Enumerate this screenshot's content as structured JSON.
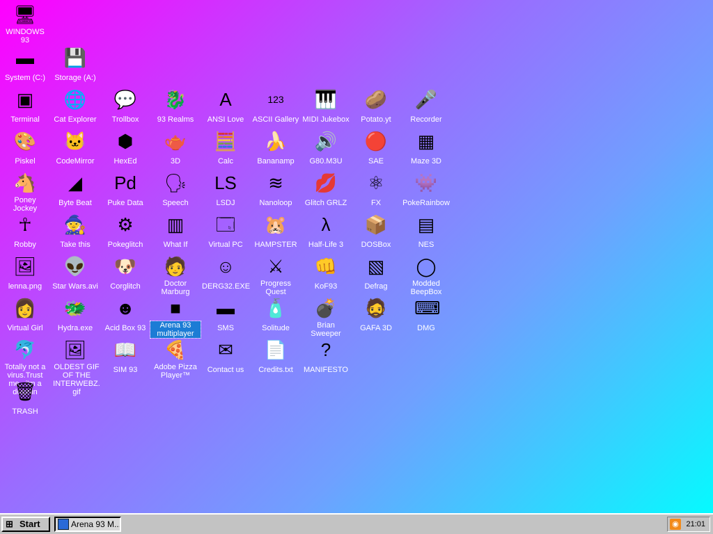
{
  "desktop": {
    "icons": [
      {
        "label": "WINDOWS 93",
        "glyph": "🖥",
        "name": "computer-icon"
      },
      {
        "label": "System (C:)",
        "glyph": "▬",
        "name": "drive-icon"
      },
      {
        "label": "Storage (A:)",
        "glyph": "💾",
        "name": "floppy-icon"
      },
      {
        "label": "Terminal",
        "glyph": "▣",
        "name": "terminal-icon"
      },
      {
        "label": "Cat Explorer",
        "glyph": "🌐",
        "name": "globe-icon"
      },
      {
        "label": "Trollbox",
        "glyph": "💬",
        "name": "chat-icon"
      },
      {
        "label": "93 Realms",
        "glyph": "🐉",
        "name": "dragon-icon"
      },
      {
        "label": "ANSI Love",
        "glyph": "A",
        "name": "ansi-icon"
      },
      {
        "label": "ASCII Gallery",
        "glyph": "123",
        "name": "ascii-icon"
      },
      {
        "label": "MIDI Jukebox",
        "glyph": "🎹",
        "name": "piano-icon"
      },
      {
        "label": "Potato.yt",
        "glyph": "🥔",
        "name": "potato-icon"
      },
      {
        "label": "Recorder",
        "glyph": "🎤",
        "name": "microphone-icon"
      },
      {
        "label": "Piskel",
        "glyph": "🎨",
        "name": "palette-icon"
      },
      {
        "label": "CodeMirror",
        "glyph": "🐱",
        "name": "cat-icon"
      },
      {
        "label": "HexEd",
        "glyph": "⬢",
        "name": "hexagon-icon"
      },
      {
        "label": "3D",
        "glyph": "🫖",
        "name": "teapot-icon"
      },
      {
        "label": "Calc",
        "glyph": "🧮",
        "name": "calculator-icon"
      },
      {
        "label": "Bananamp",
        "glyph": "🍌",
        "name": "banana-icon"
      },
      {
        "label": "G80.M3U",
        "glyph": "🔊",
        "name": "audio-file-icon"
      },
      {
        "label": "SAE",
        "glyph": "🔴",
        "name": "ball-icon"
      },
      {
        "label": "Maze 3D",
        "glyph": "▦",
        "name": "maze-icon"
      },
      {
        "label": "Poney Jockey",
        "glyph": "🐴",
        "name": "pony-icon"
      },
      {
        "label": "Byte Beat",
        "glyph": "◢",
        "name": "bytebeat-icon"
      },
      {
        "label": "Puke Data",
        "glyph": "Pd",
        "name": "puredata-icon"
      },
      {
        "label": "Speech",
        "glyph": "🗣",
        "name": "speech-icon"
      },
      {
        "label": "LSDJ",
        "glyph": "LS",
        "name": "lsdj-icon"
      },
      {
        "label": "Nanoloop",
        "glyph": "≋",
        "name": "wave-icon"
      },
      {
        "label": "Glitch GRLZ",
        "glyph": "💋",
        "name": "lips-icon"
      },
      {
        "label": "FX",
        "glyph": "⚛",
        "name": "atom-icon"
      },
      {
        "label": "PokeRainbow",
        "glyph": "👾",
        "name": "pokerainbow-icon"
      },
      {
        "label": "Robby",
        "glyph": "☥",
        "name": "stickman-icon"
      },
      {
        "label": "Take this",
        "glyph": "🧙",
        "name": "wizard-icon"
      },
      {
        "label": "Pokeglitch",
        "glyph": "⚙",
        "name": "pokeglitch-icon"
      },
      {
        "label": "What If",
        "glyph": "▥",
        "name": "whatif-icon"
      },
      {
        "label": "Virtual PC",
        "glyph": "🗔",
        "name": "window-icon"
      },
      {
        "label": "HAMPSTER",
        "glyph": "🐹",
        "name": "hamster-icon"
      },
      {
        "label": "Half-Life 3",
        "glyph": "λ",
        "name": "lambda-icon"
      },
      {
        "label": "DOSBox",
        "glyph": "📦",
        "name": "box-icon"
      },
      {
        "label": "NES",
        "glyph": "▤",
        "name": "nes-icon"
      },
      {
        "label": "lenna.png",
        "glyph": "🖼",
        "name": "image-file-icon"
      },
      {
        "label": "Star Wars.avi",
        "glyph": "👽",
        "name": "yoda-icon"
      },
      {
        "label": "Corglitch",
        "glyph": "🐶",
        "name": "corgi-icon"
      },
      {
        "label": "Doctor Marburg",
        "glyph": "🧑",
        "name": "doctor-icon"
      },
      {
        "label": "DERG32.EXE",
        "glyph": "☺",
        "name": "derg-icon"
      },
      {
        "label": "Progress Quest",
        "glyph": "⚔",
        "name": "swords-icon"
      },
      {
        "label": "KoF93",
        "glyph": "👊",
        "name": "fighter-icon"
      },
      {
        "label": "Defrag",
        "glyph": "▧",
        "name": "defrag-icon"
      },
      {
        "label": "Modded BeepBox",
        "glyph": "◯",
        "name": "ring-icon"
      },
      {
        "label": "Virtual Girl",
        "glyph": "👩",
        "name": "girl-icon"
      },
      {
        "label": "Hydra.exe",
        "glyph": "🐲",
        "name": "hydra-icon"
      },
      {
        "label": "Acid Box 93",
        "glyph": "☻",
        "name": "smiley-icon"
      },
      {
        "label": "Arena 93 multiplayer",
        "glyph": "■",
        "name": "cube-icon"
      },
      {
        "label": "SMS",
        "glyph": "▬",
        "name": "console-icon"
      },
      {
        "label": "Solitude",
        "glyph": "🧴",
        "name": "bottle-icon"
      },
      {
        "label": "Brian Sweeper",
        "glyph": "💣",
        "name": "mine-icon"
      },
      {
        "label": "GAFA 3D",
        "glyph": "🧔",
        "name": "face-icon"
      },
      {
        "label": "DMG",
        "glyph": "⌨",
        "name": "gameboy-icon"
      },
      {
        "label": "Totally not a virus.Trust me...i'm a dolphin",
        "glyph": "🐬",
        "name": "dolphin-icon"
      },
      {
        "label": "OLDEST GIF OF THE INTERWEBZ.gif",
        "glyph": "🖼",
        "name": "gif-file-icon"
      },
      {
        "label": "SIM 93",
        "glyph": "📖",
        "name": "book-icon"
      },
      {
        "label": "Adobe Pizza Player™",
        "glyph": "🍕",
        "name": "pizza-icon"
      },
      {
        "label": "Contact us",
        "glyph": "✉",
        "name": "contact-icon"
      },
      {
        "label": "Credits.txt",
        "glyph": "📄",
        "name": "text-file-icon"
      },
      {
        "label": "MANIFESTO",
        "glyph": "?",
        "name": "question-icon"
      },
      {
        "label": "TRASH",
        "glyph": "🗑",
        "name": "trash-icon"
      }
    ]
  },
  "taskbar": {
    "start_label": "Start",
    "task_label": "Arena 93 M...",
    "clock": "21:01"
  }
}
